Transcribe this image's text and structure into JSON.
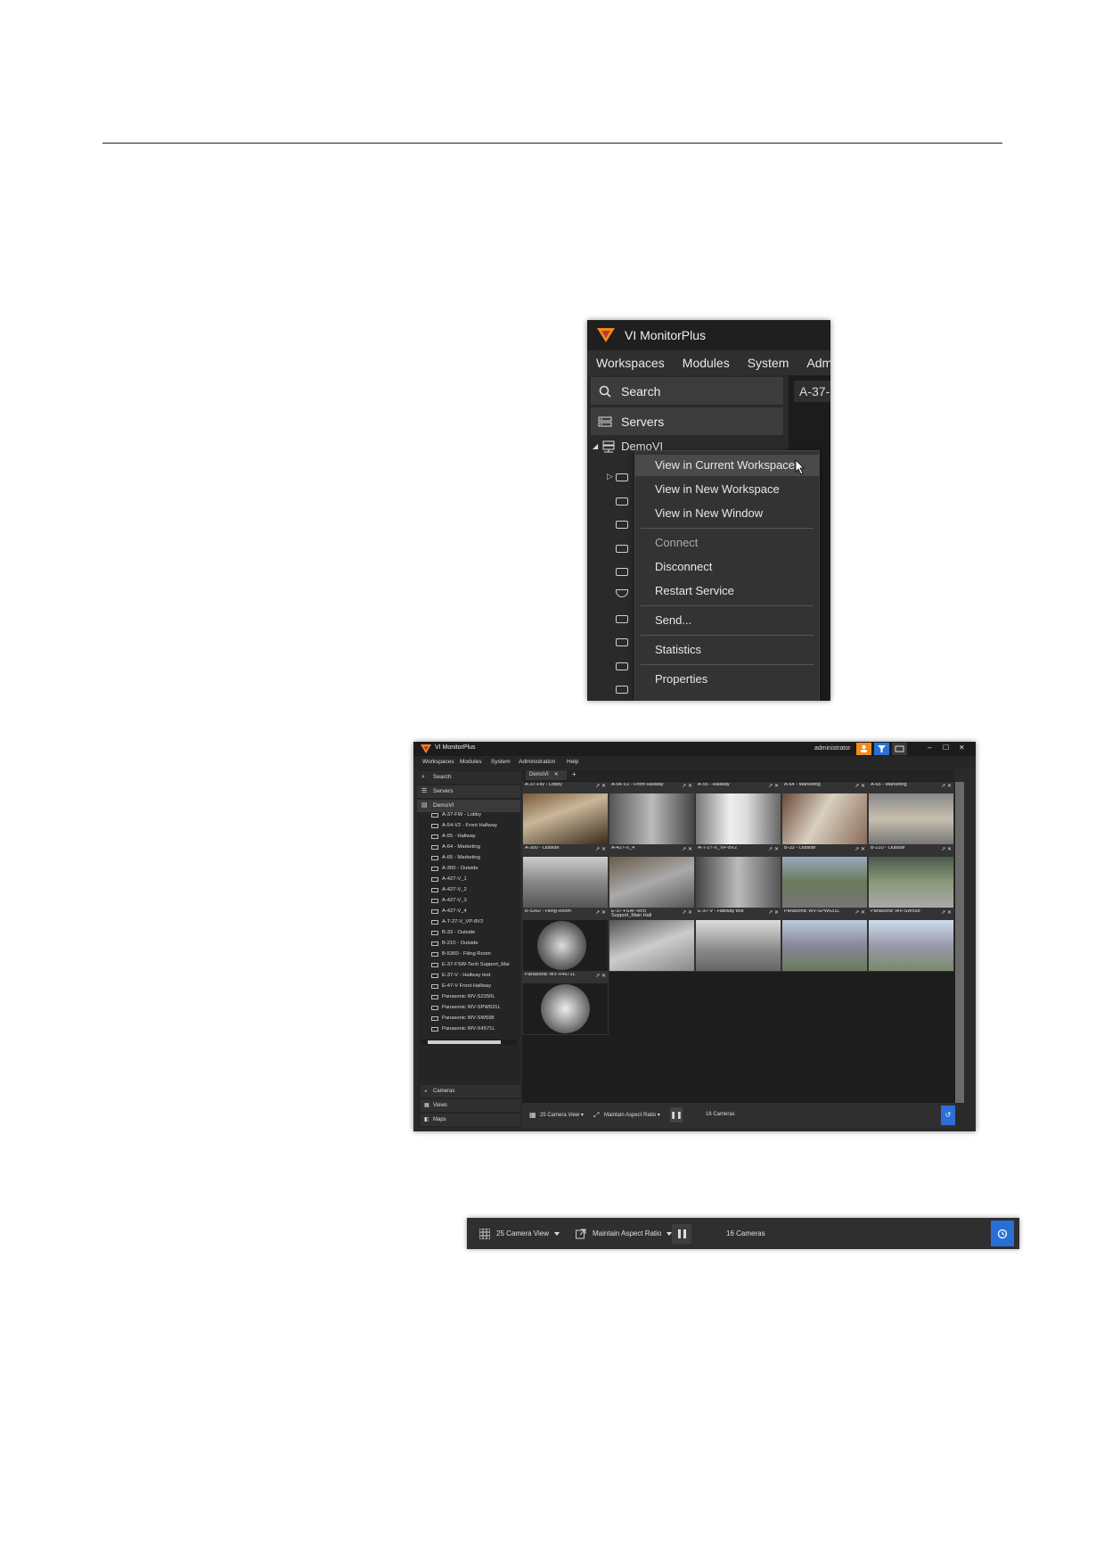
{
  "app": {
    "title": "VI MonitorPlus",
    "brand_color": "#f08a1c"
  },
  "menubar": [
    "Workspaces",
    "Modules",
    "System",
    "Admini"
  ],
  "sidebar": {
    "search_label": "Search",
    "servers_label": "Servers",
    "server_name": "DemoVI",
    "tab_label": "A-37-"
  },
  "context_menu": {
    "items": [
      {
        "label": "View in Current Workspace",
        "highlighted": true
      },
      {
        "label": "View in New Workspace"
      },
      {
        "label": "View in New Window"
      },
      {
        "label": "Connect",
        "disabled": true
      },
      {
        "label": "Disconnect"
      },
      {
        "label": "Restart Service"
      },
      {
        "label": "Send..."
      },
      {
        "label": "Statistics"
      },
      {
        "label": "Properties"
      }
    ]
  },
  "window": {
    "title": "VI MonitorPlus",
    "user": "administrator",
    "menu": [
      "Workspaces",
      "Modules",
      "System",
      "Administration",
      "Help"
    ],
    "search_label": "Search",
    "servers_label": "Servers",
    "server_name": "DemoVI",
    "workspace_tab": "DemoVI",
    "cameras_tree": [
      "A-37-FW - Lobby",
      "A-54-V2 - Front Hallway",
      "A-55 - Hallway",
      "A-64 - Marketing",
      "A-65 - Marketing",
      "A-300 - Outside",
      "A-427-V_1",
      "A-427-V_2",
      "A-427-V_3",
      "A-427-V_4",
      "A-T-27-V_VP-8V2",
      "B-33 - Outside",
      "B-210 - Outside",
      "B-5360 - Filing Room",
      "E-37-FSW-Tech Support_Mai",
      "E-37-V - Hallway test",
      "E-47-V Front Hallway",
      "Panasonic WV-S2250L",
      "Panasonic WV-SPW631L",
      "Panasonic WV-SW598",
      "Panasonic WV-X4571L"
    ],
    "bottom_nav": [
      "Cameras",
      "Views",
      "Maps"
    ],
    "tiles": [
      "A-37-FW - Lobby",
      "A-54-V2 - Front Hallway",
      "A-55 - Hallway",
      "A-64 - Marketing",
      "A-65 - Marketing",
      "A-300 - Outside",
      "A-427-V_4",
      "A-T-27-V_VP-8V2",
      "B-33 - Outside",
      "B-210 - Outside",
      "B-5360 - Filing Room",
      "E-37-FSW-Tech Support_Main Hall",
      "E-37-V - Hallway test",
      "Panasonic WV-SPW631L",
      "Panasonic WV-SW598",
      "Panasonic WV-X4571L"
    ],
    "tile_controls": "↗ ✕"
  },
  "toolbar": {
    "view_label": "25 Camera View",
    "aspect_label": "Maintain Aspect Ratio",
    "camera_count": "16 Cameras"
  },
  "colors": {
    "accent_blue": "#2a6fd6",
    "user_orange": "#f08a1c"
  }
}
